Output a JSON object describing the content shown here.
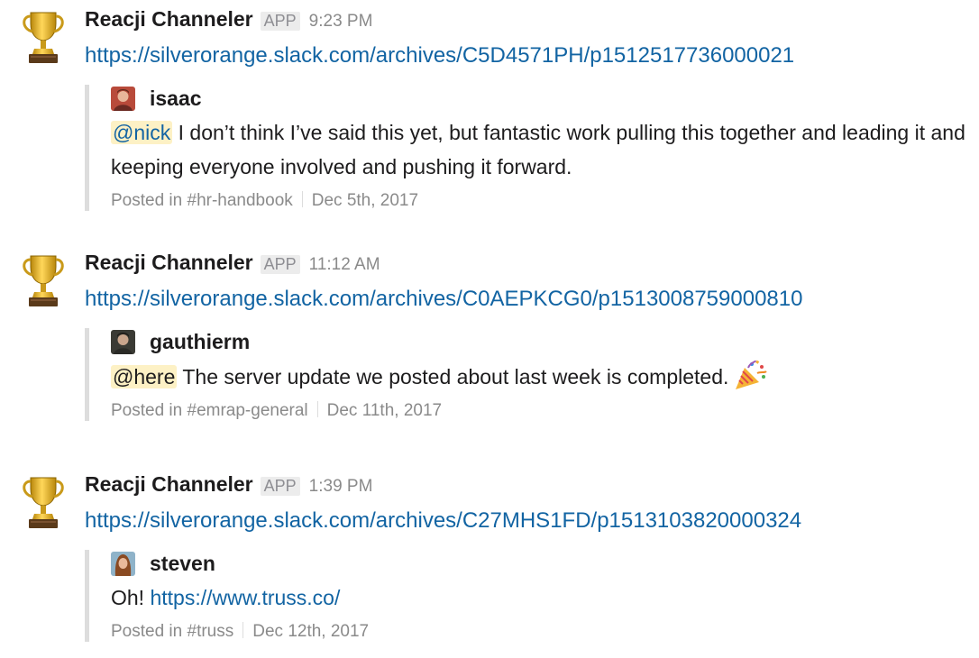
{
  "messages": [
    {
      "sender": "Reacji Channeler",
      "badge": "APP",
      "time": "9:23 PM",
      "link": "https://silverorange.slack.com/archives/C5D4571PH/p1512517736000021",
      "quote": {
        "author": "isaac",
        "mention": "@nick",
        "text": " I don’t think I’ve said this yet, but fantastic work pulling this together and leading it and keeping everyone involved and pushing it forward.",
        "posted_in": "Posted in #hr-handbook",
        "date": "Dec 5th, 2017"
      }
    },
    {
      "sender": "Reacji Channeler",
      "badge": "APP",
      "time": "11:12 AM",
      "link": "https://silverorange.slack.com/archives/C0AEPKCG0/p1513008759000810",
      "quote": {
        "author": "gauthierm",
        "mention": "@here",
        "text": " The server update we posted about last week is completed.",
        "emoji": "tada-icon",
        "posted_in": "Posted in #emrap-general",
        "date": "Dec 11th, 2017"
      }
    },
    {
      "sender": "Reacji Channeler",
      "badge": "APP",
      "time": "1:39 PM",
      "link": "https://silverorange.slack.com/archives/C27MHS1FD/p1513103820000324",
      "quote": {
        "author": "steven",
        "text_prefix": "Oh! ",
        "inline_link": "https://www.truss.co/",
        "posted_in": "Posted in #truss",
        "date": "Dec 12th, 2017"
      }
    }
  ],
  "colors": {
    "link": "#1264a3",
    "mention_bg": "#fdf1c5",
    "quote_bar": "#dddddd",
    "meta": "#8a8a8a"
  }
}
